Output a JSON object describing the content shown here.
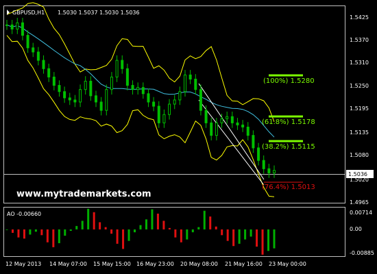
{
  "header": {
    "symbol": "GBPUSD,H1",
    "ohlc": "1.5030 1.5037 1.5030 1.5036"
  },
  "watermark": "www.mytrademarkets.com",
  "price_axis": {
    "ticks": [
      "1.5425",
      "1.5370",
      "1.5310",
      "1.5250",
      "1.5195",
      "1.5135",
      "1.5080",
      "1.5020",
      "1.4965"
    ],
    "current_price_label": "1.5036"
  },
  "fib_levels": [
    {
      "label": "(100%) 1.5280",
      "color": "#7cfc00"
    },
    {
      "label": "(61.8%) 1.5178",
      "color": "#7cfc00"
    },
    {
      "label": "(38.2%) 1.5115",
      "color": "#7cfc00"
    },
    {
      "label": "(76.4%) 1.5013",
      "color": "#e01010"
    }
  ],
  "indicator": {
    "name": "AO -0.00660",
    "ticks": [
      "0.00714",
      "0.00",
      "-0.00885"
    ]
  },
  "time_axis": [
    "12 May 2013",
    "14 May 07:00",
    "15 May 15:00",
    "16 May 23:00",
    "20 May 08:00",
    "21 May 16:00",
    "23 May 00:00"
  ],
  "colors": {
    "background": "#000000",
    "grid_frame": "#c0c0c0",
    "candle": "#00c000",
    "bollinger": "#ffff00",
    "moving_average": "#40c0e0",
    "channel": "#ffffff",
    "ao_up": "#00b000",
    "ao_down": "#e01010",
    "fib_green": "#7cfc00",
    "fib_red": "#e01010"
  },
  "chart_data": {
    "type": "line",
    "description_free": true,
    "price_close_estimates": [
      1.5385,
      1.5375,
      1.539,
      1.536,
      1.533,
      1.532,
      1.53,
      1.528,
      1.526,
      1.524,
      1.5225,
      1.521,
      1.5205,
      1.52,
      1.523,
      1.525,
      1.5215,
      1.52,
      1.518,
      1.523,
      1.526,
      1.53,
      1.528,
      1.524,
      1.523,
      1.5235,
      1.522,
      1.52,
      1.519,
      1.515,
      1.517,
      1.5195,
      1.5205,
      1.5225,
      1.5265,
      1.5255,
      1.523,
      1.518,
      1.515,
      1.512,
      1.515,
      1.516,
      1.5165,
      1.515,
      1.5145,
      1.514,
      1.512,
      1.509,
      1.506,
      1.504,
      1.503,
      1.5036
    ],
    "ao_estimates": [
      -0.0002,
      -0.0012,
      -0.0028,
      -0.0032,
      -0.0018,
      -0.0008,
      -0.002,
      -0.0045,
      -0.0062,
      -0.0048,
      -0.0022,
      -0.0005,
      0.0012,
      0.003,
      0.0072,
      0.006,
      0.0025,
      0.0008,
      -0.0015,
      -0.005,
      -0.0068,
      -0.004,
      -0.001,
      0.0015,
      0.0035,
      0.007,
      0.0055,
      0.003,
      0.0005,
      -0.0028,
      -0.0045,
      -0.0035,
      -0.001,
      0.0008,
      0.0065,
      0.0045,
      0.001,
      -0.002,
      -0.004,
      -0.0058,
      -0.005,
      -0.0035,
      -0.0025,
      -0.006,
      -0.0088,
      -0.0075,
      -0.0066
    ],
    "ylim": [
      1.4965,
      1.5425
    ],
    "ao_ylim": [
      -0.00885,
      0.00714
    ]
  }
}
